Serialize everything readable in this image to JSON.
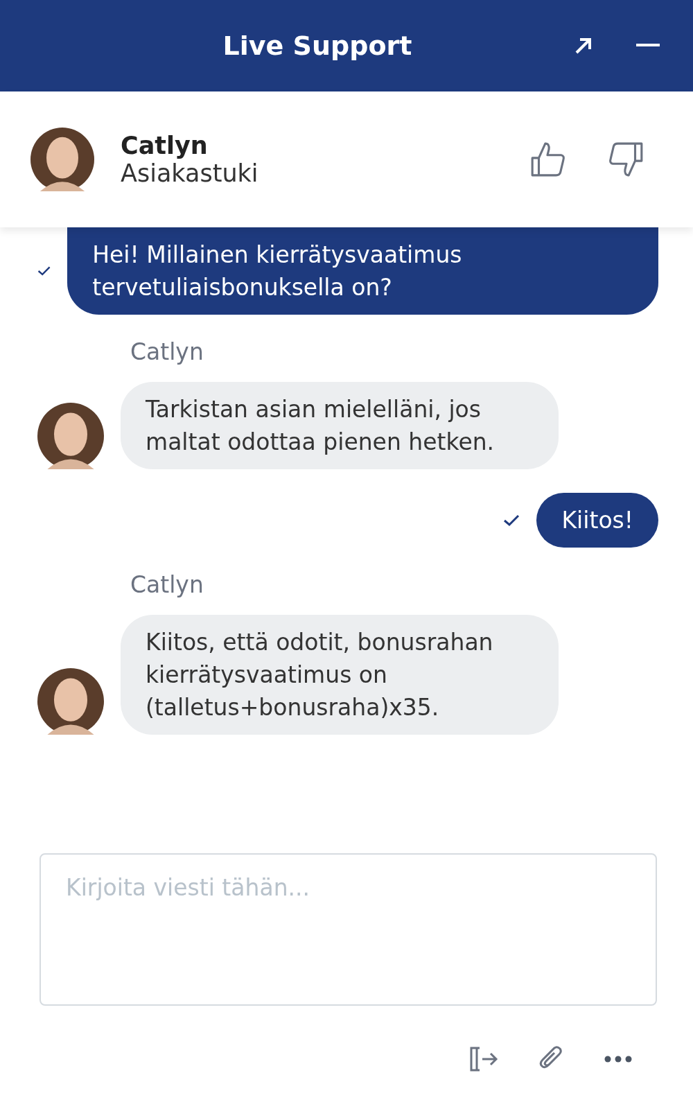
{
  "header": {
    "title": "Live Support"
  },
  "agent": {
    "name": "Catlyn",
    "role": "Asiakastuki"
  },
  "messages": [
    {
      "kind": "sent",
      "text": "Hei! Millainen kierrätysvaatimus tervetuliaisbonuksella on?",
      "read": true
    },
    {
      "kind": "received",
      "sender": "Catlyn",
      "text": "Tarkistan asian mielelläni, jos maltat odottaa pienen hetken."
    },
    {
      "kind": "sent",
      "text": "Kiitos!",
      "read": true
    },
    {
      "kind": "received",
      "sender": "Catlyn",
      "text": "Kiitos, että odotit, bonusrahan kierrätysvaatimus on (talletus+bonusraha)x35."
    }
  ],
  "composer": {
    "placeholder": "Kirjoita viesti tähän..."
  }
}
